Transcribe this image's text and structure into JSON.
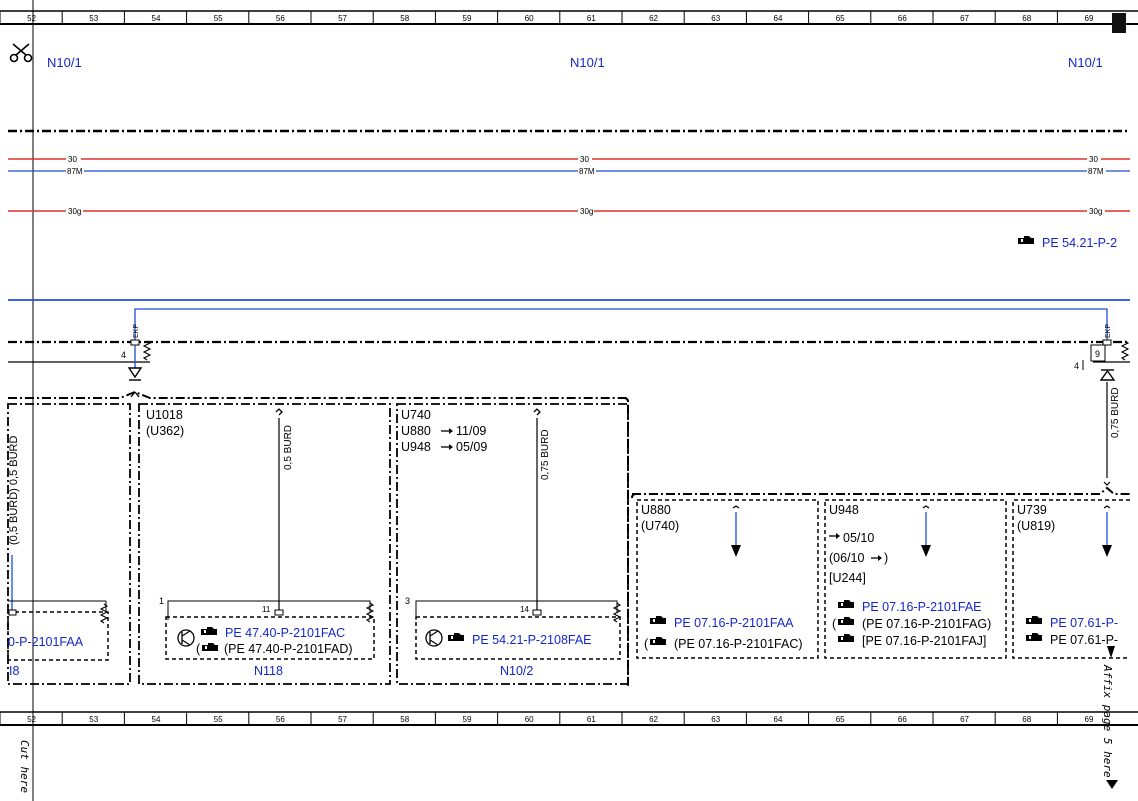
{
  "ruler": {
    "columns": [
      "52",
      "53",
      "54",
      "55",
      "56",
      "57",
      "58",
      "59",
      "60",
      "61",
      "62",
      "63",
      "64",
      "65",
      "66",
      "67",
      "68",
      "69"
    ]
  },
  "header": {
    "n10_1_left": "N10/1",
    "n10_1_mid": "N10/1",
    "n10_1_right": "N10/1"
  },
  "rails": {
    "r30": "30",
    "r87m": "87M",
    "r30g": "30g"
  },
  "refs": {
    "top_right": "PE 54.21-P-2",
    "left_box": "0-P-2101FAA",
    "n118_a": "PE 47.40-P-2101FAC",
    "n118_b": "(PE 47.40-P-2101FAD)",
    "n10_2": "PE 54.21-P-2108FAE",
    "u880_a": "PE 07.16-P-2101FAA",
    "u880_b": "(PE 07.16-P-2101FAC)",
    "u948_a": "PE 07.16-P-2101FAE",
    "u948_b": "(PE 07.16-P-2101FAG)",
    "u948_c": "[PE 07.16-P-2101FAJ]",
    "u739_a": "PE 07.61-P-",
    "u739_b": "PE 07.61-P-"
  },
  "boxes": {
    "u1018": "U1018",
    "u362": "(U362)",
    "u740": "U740",
    "u880_line": "U880",
    "u880_date": "11/09",
    "u948_line": "U948",
    "u948_date": "05/09",
    "u880": "U880",
    "u740_sub": "(U740)",
    "u948": "U948",
    "u948_d1": "05/10",
    "u948_d2": "(06/10",
    "u948_d2_end": ")",
    "u244": "[U244]",
    "u739": "U739",
    "u819": "(U819)"
  },
  "components": {
    "n118": "N118",
    "n10_2": "N10/2",
    "left_frag": "I8"
  },
  "wires": {
    "w_left": "(0,5 BURD) 0,5 BURD",
    "w_n118": "0,5 BURD",
    "w_n10_2": "0,75 BURD",
    "w_right": "0,75 BURD",
    "ekp1": "EKP",
    "ekp2": "EKP"
  },
  "pins": {
    "p4a": "4",
    "p4b": "4",
    "p9": "9",
    "p1": "1",
    "p11": "11",
    "p3": "3",
    "p14": "14"
  },
  "margin": {
    "cut_here": "Cut here",
    "affix": "Affix page 5 here"
  },
  "colors": {
    "wire_red": "#e0312b",
    "wire_blue": "#1e4fd6",
    "link_blue": "#1428c8"
  }
}
